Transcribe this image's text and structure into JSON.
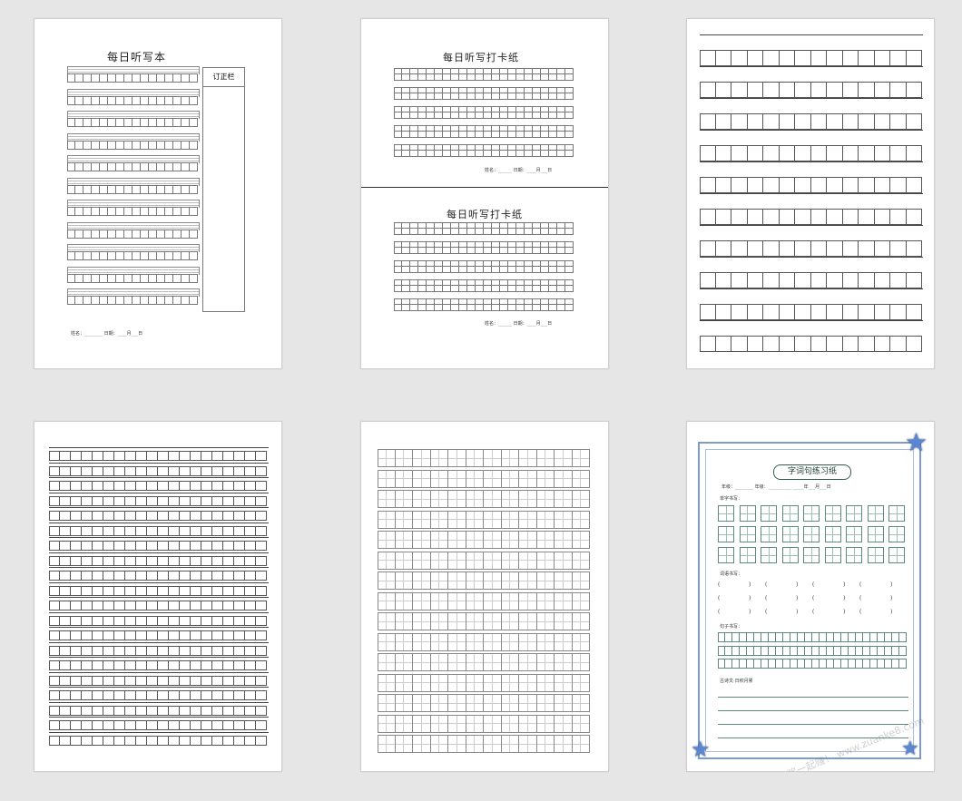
{
  "cards": {
    "c1": {
      "title": "每日听写本",
      "side_header": "订正栏",
      "footer": "姓名：________    日期：____月___日"
    },
    "c2": {
      "title_top": "每日听写打卡纸",
      "title_bottom": "每日听写打卡纸",
      "footer": "姓名：______ 日期：____月___日"
    },
    "c6": {
      "title": "字词句练习纸",
      "header_line": "年级：________    年级：__________                     _____年___月___日",
      "section_chars": "单字书写：",
      "section_words": "词语书写：",
      "section_sentences": "句子书写：",
      "section_poem": "古诗文·日积月累"
    }
  },
  "watermark": "赚客吧，有奖一起赚！ www.zuanke8.com"
}
